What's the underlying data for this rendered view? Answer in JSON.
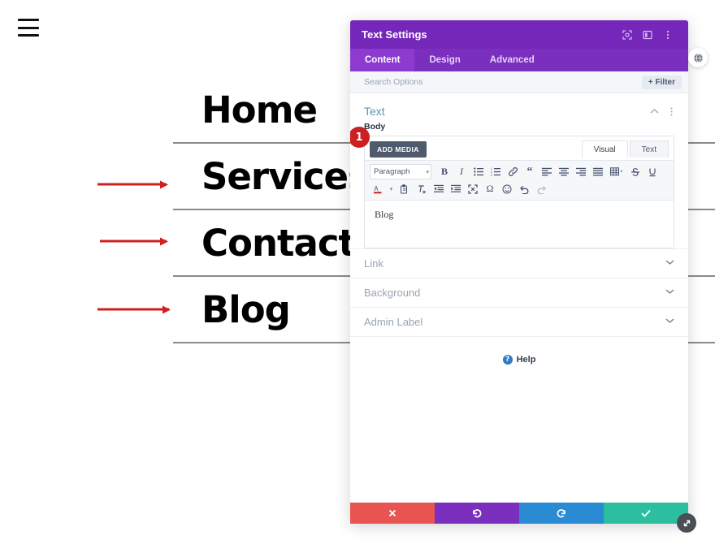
{
  "page": {
    "menu_icon": "hamburger-icon",
    "nav_items": [
      {
        "label": "Home",
        "has_arrow": false
      },
      {
        "label": "Services",
        "has_arrow": true
      },
      {
        "label": "Contact",
        "has_arrow": true
      },
      {
        "label": "Blog",
        "has_arrow": true
      }
    ]
  },
  "modal": {
    "title": "Text Settings",
    "header_icons": [
      "expand-icon",
      "layout-panel-icon",
      "more-vertical-icon"
    ],
    "tabs": [
      {
        "label": "Content",
        "active": true
      },
      {
        "label": "Design",
        "active": false
      },
      {
        "label": "Advanced",
        "active": false
      }
    ],
    "search": {
      "placeholder": "Search Options",
      "value": "",
      "filter_label": "Filter",
      "filter_icon": "plus-icon"
    },
    "section": {
      "title": "Text",
      "collapse_icon": "chevron-up-icon",
      "more_icon": "more-vertical-icon"
    },
    "body_field": {
      "label": "Body",
      "add_media_label": "ADD MEDIA",
      "editor_tabs": [
        {
          "label": "Visual",
          "active": true
        },
        {
          "label": "Text",
          "active": false
        }
      ],
      "format_select": "Paragraph",
      "toolbar_row1": [
        "bold-icon",
        "italic-icon",
        "bulleted-list-icon",
        "numbered-list-icon",
        "link-icon",
        "blockquote-icon",
        "align-left-icon",
        "align-center-icon",
        "align-right-icon",
        "align-justify-icon",
        "table-icon",
        "strikethrough-icon",
        "underline-icon"
      ],
      "toolbar_row2": [
        "text-color-icon",
        "paste-as-text-icon",
        "clear-formatting-icon",
        "decrease-indent-icon",
        "increase-indent-icon",
        "fullscreen-icon",
        "special-character-icon",
        "emoji-icon",
        "undo-icon",
        "redo-icon"
      ],
      "content": "Blog",
      "badge": "1"
    },
    "accordions": [
      {
        "label": "Link",
        "chevron": "chevron-down-icon"
      },
      {
        "label": "Background",
        "chevron": "chevron-down-icon"
      },
      {
        "label": "Admin Label",
        "chevron": "chevron-down-icon"
      }
    ],
    "help": {
      "label": "Help",
      "icon": "question-mark-icon"
    },
    "footer_buttons": [
      {
        "name": "cancel-button",
        "icon": "close-icon",
        "color": "#e8544f"
      },
      {
        "name": "undo-button",
        "icon": "undo-icon",
        "color": "#7b2fbf"
      },
      {
        "name": "redo-button",
        "icon": "redo-icon",
        "color": "#2a8bd5"
      },
      {
        "name": "save-button",
        "icon": "check-icon",
        "color": "#2bbfa0"
      }
    ]
  },
  "floating": {
    "globe_icon": "globe-icon",
    "resize_icon": "resize-handle-icon"
  },
  "colors": {
    "purple_header": "#7427b8",
    "purple_tabs": "#7b2fbf",
    "accent_red": "#cb1f23",
    "arrow_red": "#cf1f1f",
    "section_blue": "#5b93b5"
  }
}
